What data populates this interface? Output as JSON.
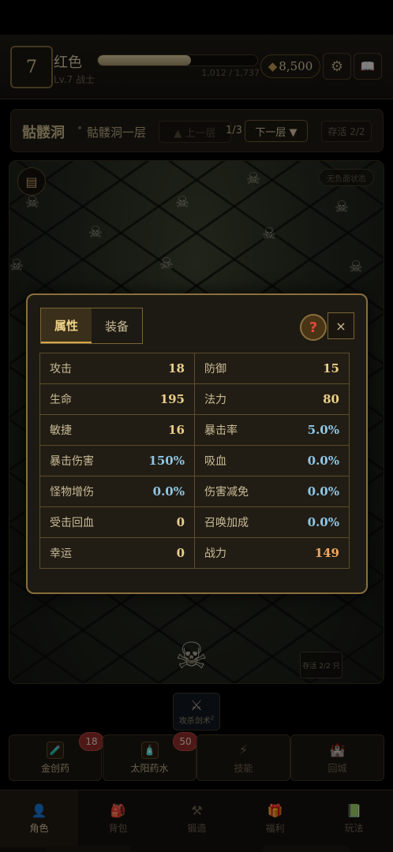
{
  "header": {
    "level": "7",
    "name": "红色",
    "subtitle": "Lv.7 战士",
    "xp_text": "1,012 / 1,737",
    "xp_progress": 0.583,
    "gold": "8,500",
    "gold_icon": "◆",
    "settings_icon": "⚙",
    "book_icon": "📖"
  },
  "location": {
    "title": "骷髅洞",
    "dot": "•",
    "floor_name": "骷髅洞一层",
    "prev_label": "▲ 上一层",
    "page": "1/3",
    "next_label": "下一层 ▼",
    "save_label": "存活 2/2"
  },
  "scene": {
    "status_label": "无负面状态",
    "count_label": "存活 2/2 只"
  },
  "attack": {
    "icon": "⚔",
    "label": "攻杀剑术",
    "sup": "2"
  },
  "actions": [
    {
      "label": "金创药",
      "badge": "18",
      "icon": "🧪"
    },
    {
      "label": "太阳药水",
      "badge": "50",
      "icon": "🧴"
    },
    {
      "label": "技能",
      "icon": "⚡"
    },
    {
      "label": "回城",
      "icon": "🏰"
    }
  ],
  "nav": [
    {
      "label": "角色",
      "icon": "👤"
    },
    {
      "label": "背包",
      "icon": "🎒"
    },
    {
      "label": "锻造",
      "icon": "⚒"
    },
    {
      "label": "福利",
      "icon": "🎁"
    },
    {
      "label": "玩法",
      "icon": "📗"
    }
  ],
  "modal": {
    "tabs": [
      "属性",
      "装备"
    ],
    "help": "?",
    "close": "×",
    "stats": [
      {
        "k": "攻击",
        "v": "18",
        "c": "gold"
      },
      {
        "k": "防御",
        "v": "15",
        "c": "gold"
      },
      {
        "k": "生命",
        "v": "195",
        "c": "gold"
      },
      {
        "k": "法力",
        "v": "80",
        "c": "gold"
      },
      {
        "k": "敏捷",
        "v": "16",
        "c": "gold"
      },
      {
        "k": "暴击率",
        "v": "5.0%",
        "c": "blue"
      },
      {
        "k": "暴击伤害",
        "v": "150%",
        "c": "blue"
      },
      {
        "k": "吸血",
        "v": "0.0%",
        "c": "blue"
      },
      {
        "k": "怪物增伤",
        "v": "0.0%",
        "c": "blue"
      },
      {
        "k": "伤害减免",
        "v": "0.0%",
        "c": "blue"
      },
      {
        "k": "受击回血",
        "v": "0",
        "c": "gold"
      },
      {
        "k": "召唤加成",
        "v": "0.0%",
        "c": "blue"
      },
      {
        "k": "幸运",
        "v": "0",
        "c": "gold"
      },
      {
        "k": "战力",
        "v": "149",
        "c": "orange"
      }
    ]
  }
}
